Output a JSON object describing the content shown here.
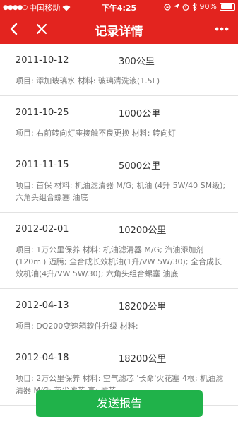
{
  "status": {
    "carrier": "中国移动",
    "time": "下午4:25",
    "battery": "90%",
    "battery_level": 0.9
  },
  "nav": {
    "title": "记录详情"
  },
  "records": [
    {
      "date": "2011-10-12",
      "km": "300公里",
      "details": "项目:  添加玻璃水 材料:  玻璃清洗液(1.5L)"
    },
    {
      "date": "2011-10-25",
      "km": "1000公里",
      "details": "项目:  右前转向灯座接触不良更换 材料:  转向灯"
    },
    {
      "date": "2011-11-15",
      "km": "5000公里",
      "details": "项目:  首保 材料:  机油滤清器 M/G;  机油 (4升 5W/40 SM级);  六角头组合螺塞 油底"
    },
    {
      "date": "2012-02-01",
      "km": "10200公里",
      "details": "项目:  1万公里保养 材料:  机油滤清器 M/G;  汽油添加剂(120ml) 迈腾;  全合成长效机油(1升/VW 5W/30);  全合成长效机油(4升/VW 5W/30);  六角头组合螺塞 油底"
    },
    {
      "date": "2012-04-13",
      "km": "18200公里",
      "details": "项目:  DQ200变速箱软件升级 材料:"
    },
    {
      "date": "2012-04-18",
      "km": "18200公里",
      "details": "项目:  2万公里保养 材料:  空气滤芯 '长命'火花塞 4根;  机油滤清器 M/G;  灰尘滤芯 高;  滤芯"
    }
  ],
  "send_button": "发送报告"
}
